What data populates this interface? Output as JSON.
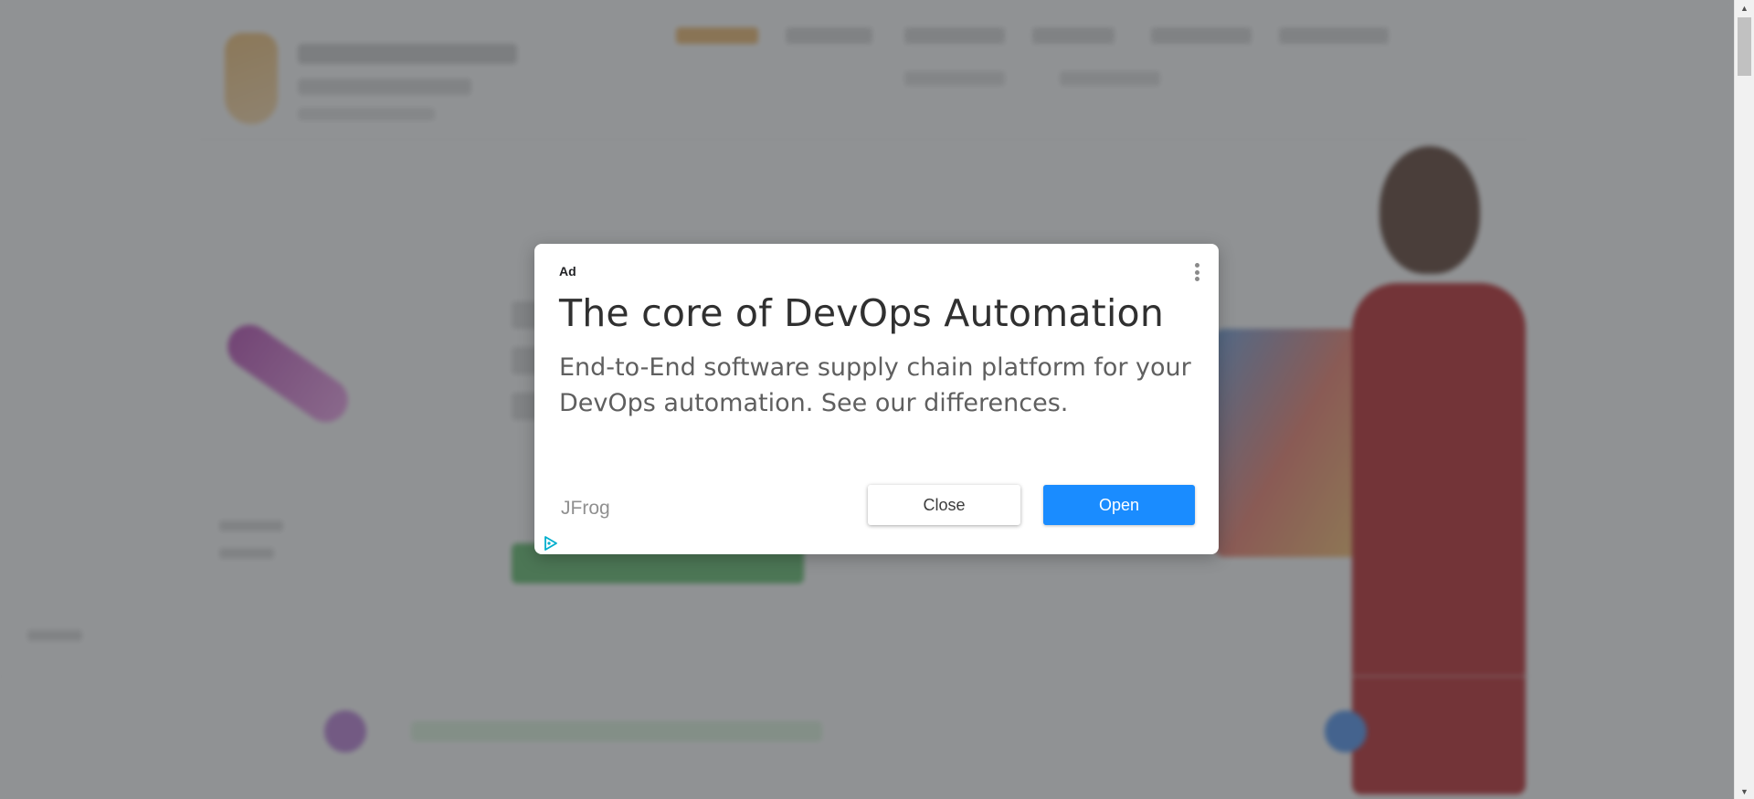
{
  "ad": {
    "label": "Ad",
    "headline": "The core of DevOps Automation",
    "description": "End-to-End software supply chain platform for your DevOps automation. See our differences.",
    "advertiser": "JFrog",
    "close_label": "Close",
    "open_label": "Open",
    "menu_icon": "vertical-dots-icon",
    "adchoices_icon": "adchoices-triangle-icon"
  },
  "colors": {
    "overlay": "#3c4043",
    "open_button": "#1a8cff",
    "headline": "#303030",
    "description": "#5f5f5f",
    "advertiser": "#909090"
  }
}
